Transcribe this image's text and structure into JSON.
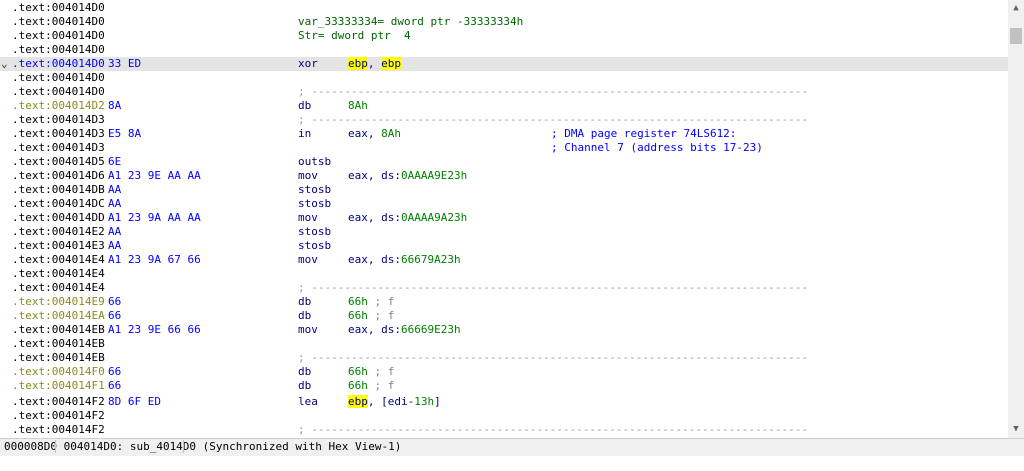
{
  "status_bar": {
    "text": "000008D0 004014D0: sub_4014D0 (Synchronized with Hex View-1)"
  },
  "scrollbar": {
    "up_icon": "▲",
    "down_icon": "▼"
  },
  "separator_text": "; ---------------------------------------------------------------------------",
  "lines": [
    {
      "addr": ".text:004014D0"
    },
    {
      "addr": ".text:004014D0"
    },
    {
      "addr": ".text:004014D0"
    },
    {
      "addr": ".text:004014D0"
    },
    {
      "addr": ".text:004014D0",
      "bytes": "33 ED",
      "selected": true
    },
    {
      "addr": ".text:004014D0"
    },
    {
      "addr": ".text:004014D0"
    },
    {
      "addr": ".text:004014D2",
      "bytes": "8A",
      "addr_style": "data"
    },
    {
      "addr": ".text:004014D3"
    },
    {
      "addr": ".text:004014D3",
      "bytes": "E5 8A"
    },
    {
      "addr": ".text:004014D3"
    },
    {
      "addr": ".text:004014D5",
      "bytes": "6E"
    },
    {
      "addr": ".text:004014D6",
      "bytes": "A1 23 9E AA AA"
    },
    {
      "addr": ".text:004014DB",
      "bytes": "AA"
    },
    {
      "addr": ".text:004014DC",
      "bytes": "AA"
    },
    {
      "addr": ".text:004014DD",
      "bytes": "A1 23 9A AA AA"
    },
    {
      "addr": ".text:004014E2",
      "bytes": "AA"
    },
    {
      "addr": ".text:004014E3",
      "bytes": "AA"
    },
    {
      "addr": ".text:004014E4",
      "bytes": "A1 23 9A 67 66"
    },
    {
      "addr": ".text:004014E4"
    },
    {
      "addr": ".text:004014E4"
    },
    {
      "addr": ".text:004014E9",
      "bytes": "66",
      "addr_style": "data"
    },
    {
      "addr": ".text:004014EA",
      "bytes": "66",
      "addr_style": "data"
    },
    {
      "addr": ".text:004014EB",
      "bytes": "A1 23 9E 66 66"
    },
    {
      "addr": ".text:004014EB"
    },
    {
      "addr": ".text:004014EB"
    },
    {
      "addr": ".text:004014F0",
      "bytes": "66",
      "addr_style": "data"
    },
    {
      "addr": ".text:004014F1",
      "bytes": "66",
      "addr_style": "data"
    },
    {
      "addr": ".text:004014F2",
      "bytes": "8D 6F ED"
    },
    {
      "addr": ".text:004014F2"
    },
    {
      "addr": ".text:004014F2"
    }
  ],
  "var_def": {
    "name": "var_33333334",
    "eq": "= dword ptr ",
    "value": "-33333334h"
  },
  "str_def": {
    "name": "Str",
    "eq": "= dword ptr  ",
    "value": "4"
  },
  "xor_line": {
    "mn": "xor",
    "reg1": "ebp",
    "comma": ", ",
    "reg2": "ebp"
  },
  "db_8a": {
    "mn": "db",
    "val": "8Ah"
  },
  "in_line": {
    "mn": "in",
    "op_a": "eax, ",
    "op_b": "8Ah",
    "comment": "; DMA page register 74LS612:"
  },
  "in_cont": {
    "comment": "; Channel 7 (address bits 17-23)"
  },
  "outsb": {
    "mn": "outsb"
  },
  "mov1": {
    "mn": "mov",
    "op_a": "eax, ds:",
    "op_b": "0AAAA9E23h"
  },
  "stosb1": {
    "mn": "stosb"
  },
  "stosb2": {
    "mn": "stosb"
  },
  "mov2": {
    "mn": "mov",
    "op_a": "eax, ds:",
    "op_b": "0AAAA9A23h"
  },
  "stosb3": {
    "mn": "stosb"
  },
  "stosb4": {
    "mn": "stosb"
  },
  "mov3": {
    "mn": "mov",
    "op_a": "eax, ds:",
    "op_b": "66679A23h"
  },
  "db_66a": {
    "mn": "db",
    "val": "66h",
    "cm": " ; f"
  },
  "db_66b": {
    "mn": "db",
    "val": "66h",
    "cm": " ; f"
  },
  "mov4": {
    "mn": "mov",
    "op_a": "eax, ds:",
    "op_b": "66669E23h"
  },
  "db_66c": {
    "mn": "db",
    "val": "66h",
    "cm": " ; f"
  },
  "db_66d": {
    "mn": "db",
    "val": "66h",
    "cm": " ; f"
  },
  "lea": {
    "mn": "lea",
    "reg": "ebp",
    "op_a": ", [edi-",
    "op_b": "13h",
    "op_c": "]"
  }
}
